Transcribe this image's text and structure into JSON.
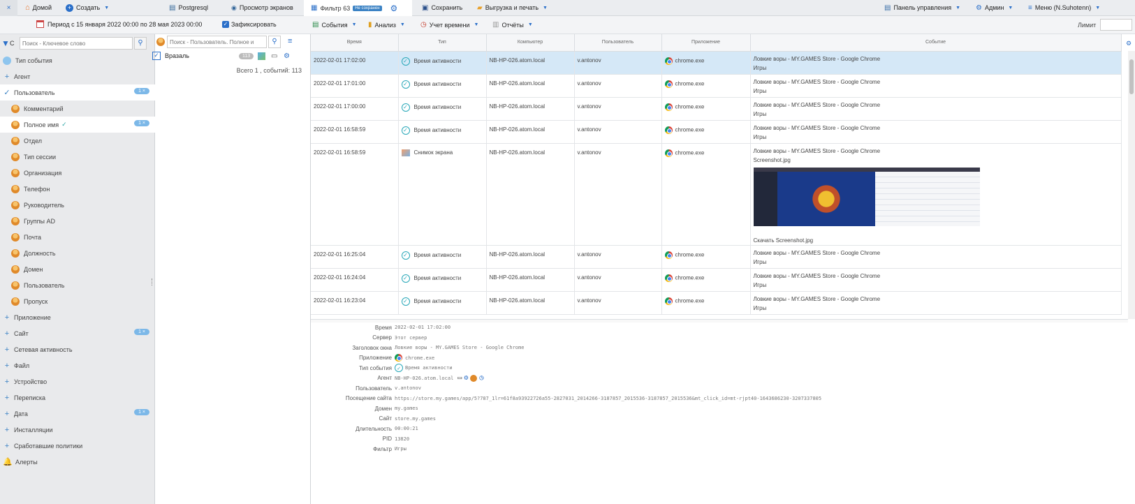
{
  "topbar": {
    "home": "Домой",
    "create": "Создать",
    "postgresql": "Postgresql",
    "screens": "Просмотр экранов",
    "filter_tab": "Фильтр 63",
    "unsaved_badge": "Не сохранен",
    "save": "Сохранить",
    "export": "Выгрузка и печать",
    "dashboard": "Панель управления",
    "admin": "Админ",
    "menu": "Меню (N.Suhotenn)"
  },
  "period": {
    "text": "Период с 15 января 2022 00:00 по 28 мая 2023 00:00",
    "pin_label": "Зафиксировать"
  },
  "toolbar": {
    "events": "События",
    "analysis": "Анализ",
    "time_tracking": "Учет времени",
    "reports": "Отчёты",
    "limit_label": "Лимит"
  },
  "sidebar": {
    "search_placeholder": "Поиск - Ключевое слово",
    "filter_letter": "С",
    "items": [
      {
        "label": "Тип события",
        "kind": "top",
        "icon": "event-type-icon"
      },
      {
        "label": "Агент",
        "kind": "top",
        "exp": "+"
      },
      {
        "label": "Пользователь",
        "kind": "top",
        "exp": "✓",
        "badge": "1 ×",
        "active": true
      },
      {
        "label": "Комментарий",
        "kind": "sub"
      },
      {
        "label": "Полное имя",
        "kind": "sub",
        "badge": "1 ×",
        "check": true,
        "active": true
      },
      {
        "label": "Отдел",
        "kind": "sub"
      },
      {
        "label": "Тип сессии",
        "kind": "sub"
      },
      {
        "label": "Организация",
        "kind": "sub"
      },
      {
        "label": "Телефон",
        "kind": "sub"
      },
      {
        "label": "Руководитель",
        "kind": "sub"
      },
      {
        "label": "Группы AD",
        "kind": "sub"
      },
      {
        "label": "Почта",
        "kind": "sub"
      },
      {
        "label": "Должность",
        "kind": "sub"
      },
      {
        "label": "Домен",
        "kind": "sub"
      },
      {
        "label": "Пользователь",
        "kind": "sub"
      },
      {
        "label": "Пропуск",
        "kind": "sub"
      },
      {
        "label": "Приложение",
        "kind": "top",
        "exp": "+"
      },
      {
        "label": "Сайт",
        "kind": "top",
        "exp": "+",
        "badge": "1 ×"
      },
      {
        "label": "Сетевая активность",
        "kind": "top",
        "exp": "+"
      },
      {
        "label": "Файл",
        "kind": "top",
        "exp": "+"
      },
      {
        "label": "Устройство",
        "kind": "top",
        "exp": "+"
      },
      {
        "label": "Переписка",
        "kind": "top",
        "exp": "+"
      },
      {
        "label": "Дата",
        "kind": "top",
        "exp": "+",
        "badge": "1 ×"
      },
      {
        "label": "Инсталляции",
        "kind": "top",
        "exp": "+"
      },
      {
        "label": "Сработавшие политики",
        "kind": "top",
        "exp": "+"
      },
      {
        "label": "Алерты",
        "kind": "top",
        "icon": "bell-icon"
      }
    ]
  },
  "mid": {
    "search_placeholder": "Поиск - Пользователь. Полное и",
    "result_label": "Вразаль",
    "result_count": "113",
    "total": "Всего 1 , событий: 113"
  },
  "table": {
    "columns": [
      "Время",
      "Тип",
      "Компьютер",
      "Пользователь",
      "Приложение",
      "Событие"
    ],
    "rows": [
      {
        "time": "2022-02-01 17:02:00",
        "type": "Время активности",
        "computer": "NB-HP-026.atom.local",
        "user": "v.antonov",
        "app": "chrome.exe",
        "event": "Ловкие воры - MY.GAMES Store - Google Chrome",
        "event2": "Игры",
        "selected": true
      },
      {
        "time": "2022-02-01 17:01:00",
        "type": "Время активности",
        "computer": "NB-HP-026.atom.local",
        "user": "v.antonov",
        "app": "chrome.exe",
        "event": "Ловкие воры - MY.GAMES Store - Google Chrome",
        "event2": "Игры"
      },
      {
        "time": "2022-02-01 17:00:00",
        "type": "Время активности",
        "computer": "NB-HP-026.atom.local",
        "user": "v.antonov",
        "app": "chrome.exe",
        "event": "Ловкие воры - MY.GAMES Store - Google Chrome",
        "event2": "Игры"
      },
      {
        "time": "2022-02-01 16:58:59",
        "type": "Время активности",
        "computer": "NB-HP-026.atom.local",
        "user": "v.antonov",
        "app": "chrome.exe",
        "event": "Ловкие воры - MY.GAMES Store - Google Chrome",
        "event2": "Игры"
      },
      {
        "time": "2022-02-01 16:58:59",
        "type": "Снимок экрана",
        "computer": "NB-HP-026.atom.local",
        "user": "v.antonov",
        "app": "chrome.exe",
        "event": "Ловкие воры - MY.GAMES Store - Google Chrome",
        "event2": "Screenshot.jpg",
        "download": "Скачать Screenshot.jpg",
        "screenshot": true
      },
      {
        "time": "2022-02-01 16:25:04",
        "type": "Время активности",
        "computer": "NB-HP-026.atom.local",
        "user": "v.antonov",
        "app": "chrome.exe",
        "event": "Ловкие воры - MY.GAMES Store - Google Chrome",
        "event2": "Игры"
      },
      {
        "time": "2022-02-01 16:24:04",
        "type": "Время активности",
        "computer": "NB-HP-026.atom.local",
        "user": "v.antonov",
        "app": "chrome.exe",
        "event": "Ловкие воры - MY.GAMES Store - Google Chrome",
        "event2": "Игры"
      },
      {
        "time": "2022-02-01 16:23:04",
        "type": "Время активности",
        "computer": "NB-HP-026.atom.local",
        "user": "v.antonov",
        "app": "chrome.exe",
        "event": "Ловкие воры - MY.GAMES Store - Google Chrome",
        "event2": "Игры"
      }
    ]
  },
  "details": [
    {
      "label": "Время",
      "value": "2022-02-01 17:02:00"
    },
    {
      "label": "Сервер",
      "value": "Этот сервер"
    },
    {
      "label": "Заголовок окна",
      "value": "Ловкие воры - MY.GAMES Store - Google Chrome"
    },
    {
      "label": "Приложение",
      "value": "chrome.exe",
      "icon": "chrome"
    },
    {
      "label": "Тип события",
      "value": "Время активности",
      "icon": "ok"
    },
    {
      "label": "Агент",
      "value": "NB-HP-026.atom.local",
      "icon": "agent"
    },
    {
      "label": "Пользователь",
      "value": "v.antonov"
    },
    {
      "label": "Посещение сайта",
      "value": "https://store.my.games/app/5?787_1lr=61f8a93922726a55-2827031_2014266-3187857_2015536-3187857_2015536&mt_click_id=mt-rjpt40-1643686230-3207337805"
    },
    {
      "label": "Домен",
      "value": "my.games"
    },
    {
      "label": "Сайт",
      "value": "store.my.games"
    },
    {
      "label": "Длительность",
      "value": "00:00:21"
    },
    {
      "label": "PID",
      "value": "13820"
    },
    {
      "label": "Фильтр",
      "value": "Игры"
    }
  ],
  "colors": {
    "accent": "#2a6fc9",
    "selected_row": "#d5e8f7",
    "badge": "#7cb8e8",
    "sidebar_bg": "#e9eaec"
  }
}
